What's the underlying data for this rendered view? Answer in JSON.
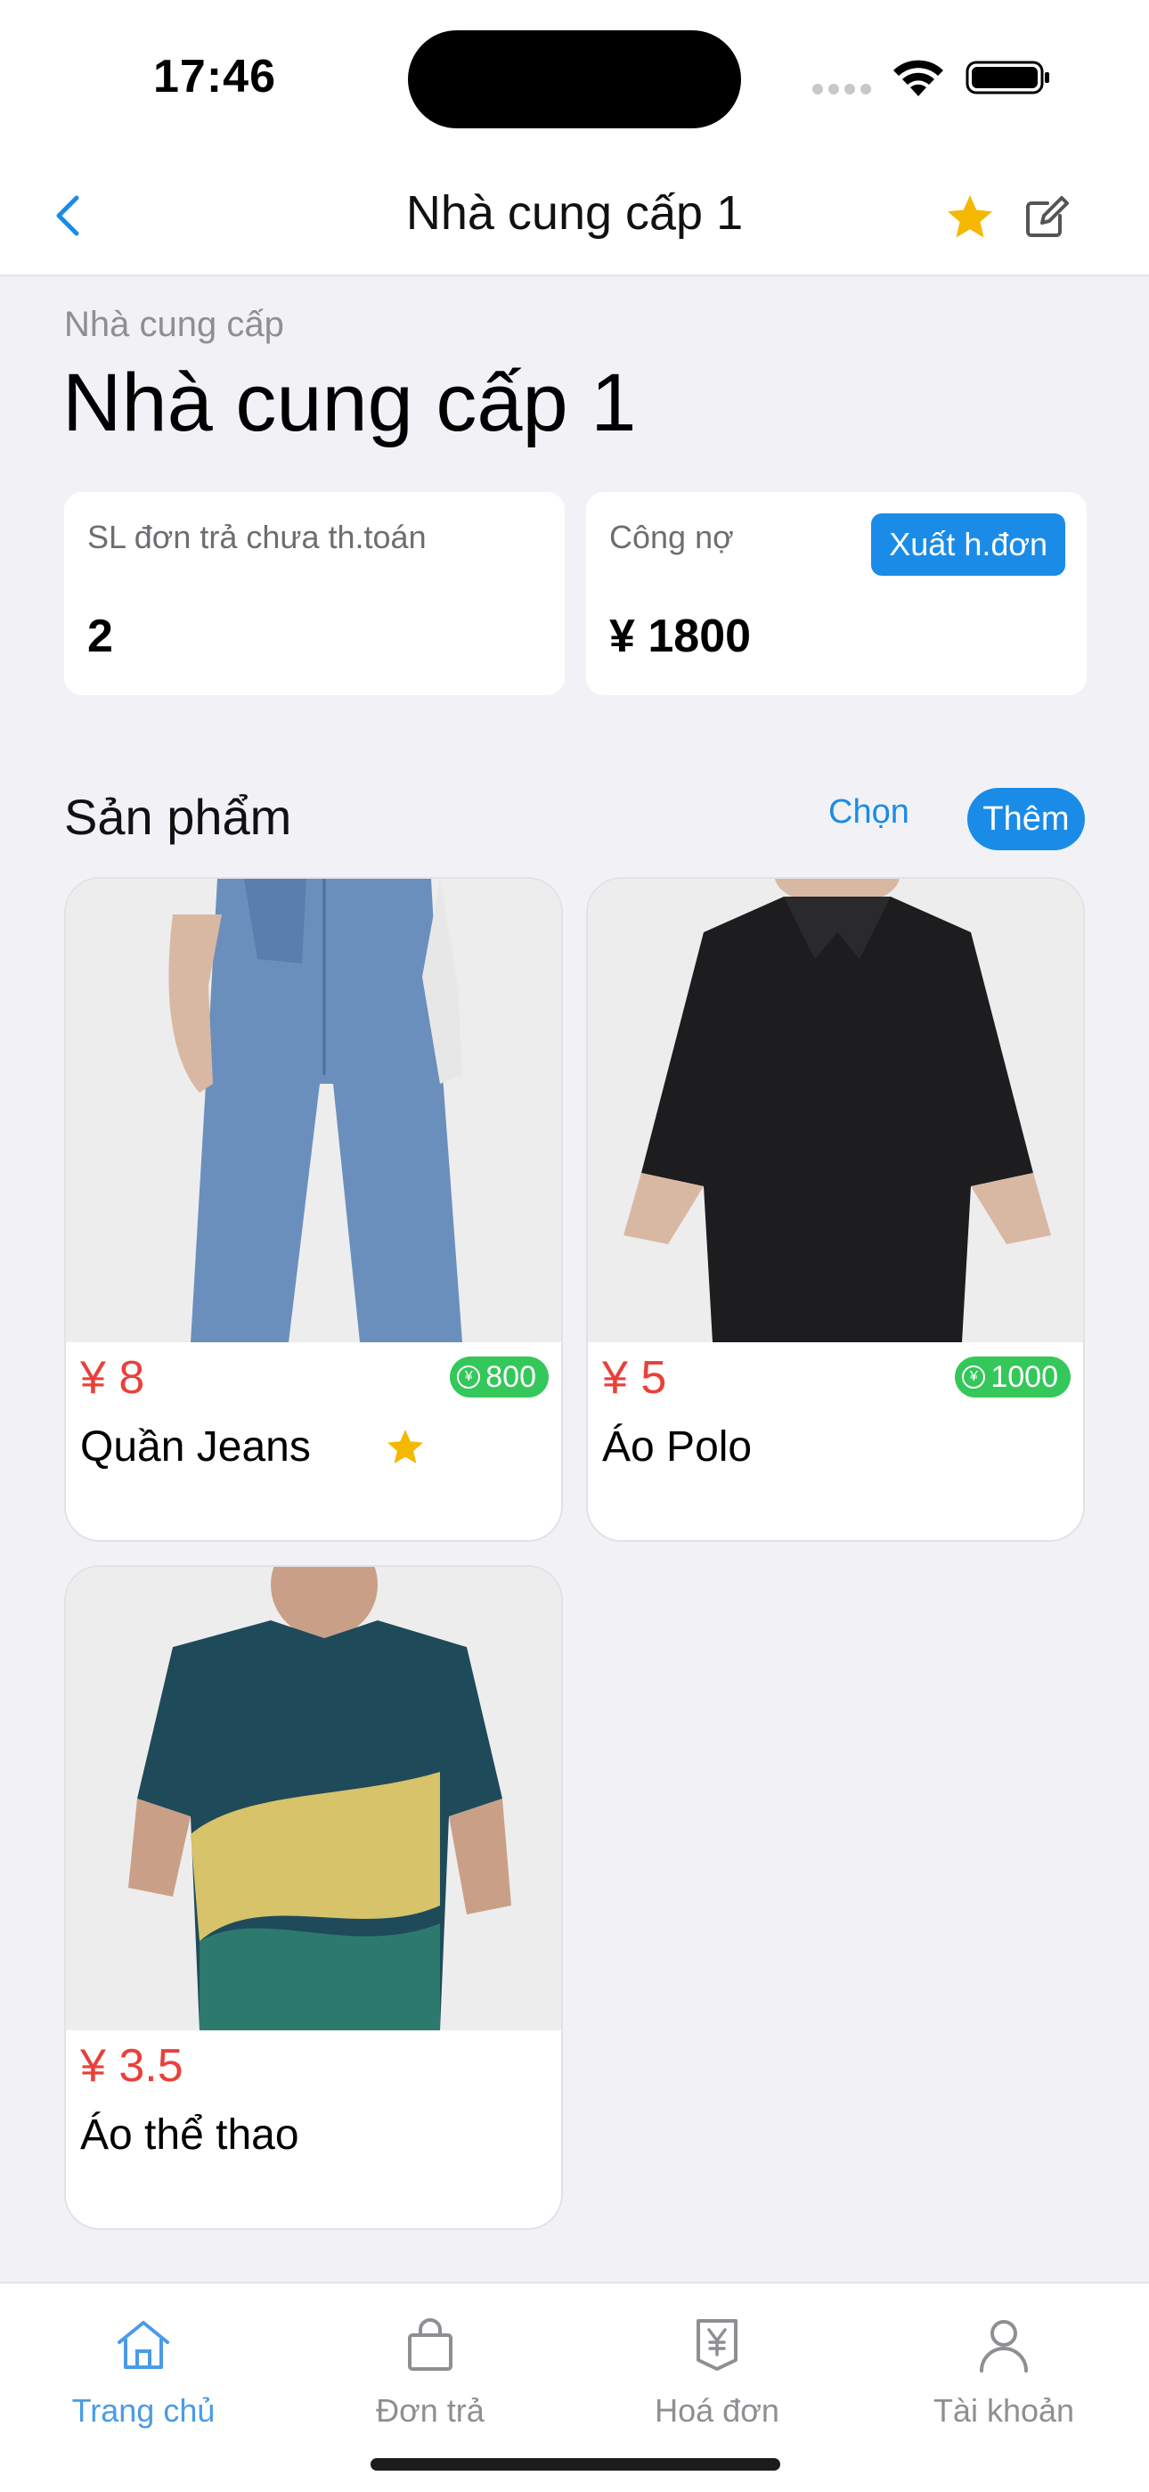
{
  "status_bar": {
    "time": "17:46"
  },
  "header": {
    "title": "Nhà cung cấp 1"
  },
  "supplier": {
    "caption": "Nhà cung cấp",
    "name": "Nhà cung cấp 1"
  },
  "stats": {
    "unpaid_label": "SL đơn trả chưa th.toán",
    "unpaid_value": "2",
    "debt_label": "Công nợ",
    "debt_value": "¥ 1800",
    "export_label": "Xuất h.đơn"
  },
  "products_section": {
    "title": "Sản phẩm",
    "choose_label": "Chọn",
    "add_label": "Thêm"
  },
  "products": [
    {
      "price": "¥ 8",
      "name": "Quần Jeans",
      "stock": "800",
      "favorite": true
    },
    {
      "price": "¥ 5",
      "name": "Áo Polo",
      "stock": "1000",
      "favorite": false
    },
    {
      "price": "¥ 3.5",
      "name": "Áo thể thao",
      "stock": "",
      "favorite": false
    }
  ],
  "tabs": [
    {
      "label": "Trang chủ",
      "icon": "home-icon",
      "active": true
    },
    {
      "label": "Đơn trả",
      "icon": "bag-icon",
      "active": false
    },
    {
      "label": "Hoá đơn",
      "icon": "invoice-icon",
      "active": false
    },
    {
      "label": "Tài khoản",
      "icon": "user-icon",
      "active": false
    }
  ],
  "colors": {
    "accent": "#1a8ce8",
    "price": "#e8413a",
    "stock_badge": "#34c759",
    "star": "#f5b800"
  }
}
